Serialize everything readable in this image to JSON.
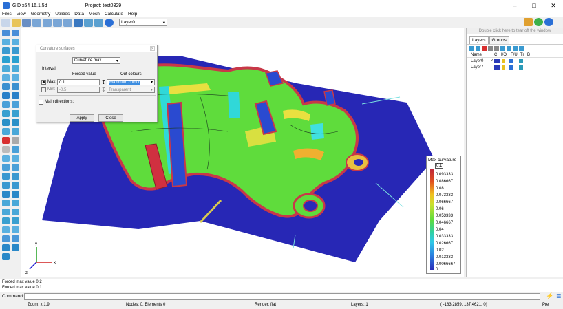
{
  "window": {
    "app_title": "GiD x64 16.1.5d",
    "project": "Project: test0329"
  },
  "menu": [
    "Files",
    "View",
    "Geometry",
    "Utilities",
    "Data",
    "Mesh",
    "Calculate",
    "Help"
  ],
  "toolbar": {
    "layer_select": "Layer0"
  },
  "right_panel": {
    "tear_off": "Double click here to tear off the window",
    "tabs": [
      "Layers",
      "Groups"
    ],
    "columns": [
      "Name",
      "C",
      "I/O",
      "F/U",
      "Tr",
      "B"
    ],
    "layers": [
      "Layer0",
      "Layer7"
    ]
  },
  "dialog": {
    "title": "Curvature surfaces",
    "mode": "Curvature max",
    "interval_label": "Interval",
    "forced_value_header": "Forced value",
    "out_colours_header": "Out colours",
    "max_label": "Max:",
    "max_value": "0.1",
    "max_colour": "Maximum colour",
    "min_label": "Min:",
    "min_value": "-0.5",
    "min_colour": "Transparent",
    "main_directions": "Main directions:",
    "apply": "Apply",
    "close": "Close"
  },
  "legend": {
    "title": "Max curvature",
    "top": "0.1",
    "values": [
      "0.093333",
      "0.086667",
      "0.08",
      "0.073333",
      "0.066667",
      "0.06",
      "0.053333",
      "0.046667",
      "0.04",
      "0.033333",
      "0.026667",
      "0.02",
      "0.013333",
      "0.0066667",
      "0"
    ]
  },
  "axes": {
    "x": "x",
    "y": "y",
    "z": "z"
  },
  "status_messages": [
    "Forced max value 0.2",
    "Forced max value 0.1"
  ],
  "command_label": "Command:",
  "bottom_bar": {
    "zoom": "Zoom: x 1.9",
    "nodes": "Nodes: 0, Elements 0",
    "render": "Render: flat",
    "layers": "Layers: 1",
    "coords": "( -183.2859, 137.4621, 0)",
    "pre": "Pre"
  },
  "colors": {
    "accent": "#2a6fd6",
    "mesh_blue": "#2a2ab8",
    "surface_green": "#5fdc3c"
  }
}
